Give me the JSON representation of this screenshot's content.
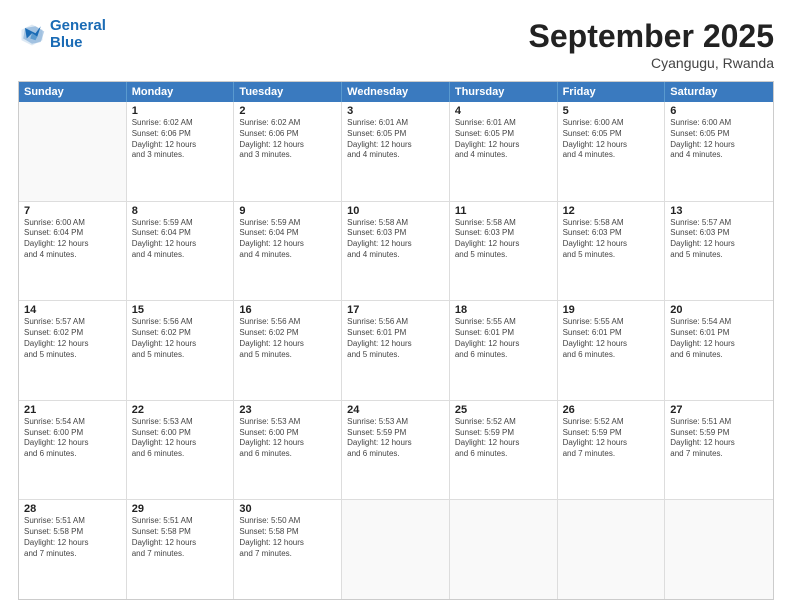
{
  "logo": {
    "line1": "General",
    "line2": "Blue"
  },
  "title": "September 2025",
  "subtitle": "Cyangugu, Rwanda",
  "header_days": [
    "Sunday",
    "Monday",
    "Tuesday",
    "Wednesday",
    "Thursday",
    "Friday",
    "Saturday"
  ],
  "rows": [
    [
      {
        "day": "",
        "info": ""
      },
      {
        "day": "1",
        "info": "Sunrise: 6:02 AM\nSunset: 6:06 PM\nDaylight: 12 hours\nand 3 minutes."
      },
      {
        "day": "2",
        "info": "Sunrise: 6:02 AM\nSunset: 6:06 PM\nDaylight: 12 hours\nand 3 minutes."
      },
      {
        "day": "3",
        "info": "Sunrise: 6:01 AM\nSunset: 6:05 PM\nDaylight: 12 hours\nand 4 minutes."
      },
      {
        "day": "4",
        "info": "Sunrise: 6:01 AM\nSunset: 6:05 PM\nDaylight: 12 hours\nand 4 minutes."
      },
      {
        "day": "5",
        "info": "Sunrise: 6:00 AM\nSunset: 6:05 PM\nDaylight: 12 hours\nand 4 minutes."
      },
      {
        "day": "6",
        "info": "Sunrise: 6:00 AM\nSunset: 6:05 PM\nDaylight: 12 hours\nand 4 minutes."
      }
    ],
    [
      {
        "day": "7",
        "info": "Sunrise: 6:00 AM\nSunset: 6:04 PM\nDaylight: 12 hours\nand 4 minutes."
      },
      {
        "day": "8",
        "info": "Sunrise: 5:59 AM\nSunset: 6:04 PM\nDaylight: 12 hours\nand 4 minutes."
      },
      {
        "day": "9",
        "info": "Sunrise: 5:59 AM\nSunset: 6:04 PM\nDaylight: 12 hours\nand 4 minutes."
      },
      {
        "day": "10",
        "info": "Sunrise: 5:58 AM\nSunset: 6:03 PM\nDaylight: 12 hours\nand 4 minutes."
      },
      {
        "day": "11",
        "info": "Sunrise: 5:58 AM\nSunset: 6:03 PM\nDaylight: 12 hours\nand 5 minutes."
      },
      {
        "day": "12",
        "info": "Sunrise: 5:58 AM\nSunset: 6:03 PM\nDaylight: 12 hours\nand 5 minutes."
      },
      {
        "day": "13",
        "info": "Sunrise: 5:57 AM\nSunset: 6:03 PM\nDaylight: 12 hours\nand 5 minutes."
      }
    ],
    [
      {
        "day": "14",
        "info": "Sunrise: 5:57 AM\nSunset: 6:02 PM\nDaylight: 12 hours\nand 5 minutes."
      },
      {
        "day": "15",
        "info": "Sunrise: 5:56 AM\nSunset: 6:02 PM\nDaylight: 12 hours\nand 5 minutes."
      },
      {
        "day": "16",
        "info": "Sunrise: 5:56 AM\nSunset: 6:02 PM\nDaylight: 12 hours\nand 5 minutes."
      },
      {
        "day": "17",
        "info": "Sunrise: 5:56 AM\nSunset: 6:01 PM\nDaylight: 12 hours\nand 5 minutes."
      },
      {
        "day": "18",
        "info": "Sunrise: 5:55 AM\nSunset: 6:01 PM\nDaylight: 12 hours\nand 6 minutes."
      },
      {
        "day": "19",
        "info": "Sunrise: 5:55 AM\nSunset: 6:01 PM\nDaylight: 12 hours\nand 6 minutes."
      },
      {
        "day": "20",
        "info": "Sunrise: 5:54 AM\nSunset: 6:01 PM\nDaylight: 12 hours\nand 6 minutes."
      }
    ],
    [
      {
        "day": "21",
        "info": "Sunrise: 5:54 AM\nSunset: 6:00 PM\nDaylight: 12 hours\nand 6 minutes."
      },
      {
        "day": "22",
        "info": "Sunrise: 5:53 AM\nSunset: 6:00 PM\nDaylight: 12 hours\nand 6 minutes."
      },
      {
        "day": "23",
        "info": "Sunrise: 5:53 AM\nSunset: 6:00 PM\nDaylight: 12 hours\nand 6 minutes."
      },
      {
        "day": "24",
        "info": "Sunrise: 5:53 AM\nSunset: 5:59 PM\nDaylight: 12 hours\nand 6 minutes."
      },
      {
        "day": "25",
        "info": "Sunrise: 5:52 AM\nSunset: 5:59 PM\nDaylight: 12 hours\nand 6 minutes."
      },
      {
        "day": "26",
        "info": "Sunrise: 5:52 AM\nSunset: 5:59 PM\nDaylight: 12 hours\nand 7 minutes."
      },
      {
        "day": "27",
        "info": "Sunrise: 5:51 AM\nSunset: 5:59 PM\nDaylight: 12 hours\nand 7 minutes."
      }
    ],
    [
      {
        "day": "28",
        "info": "Sunrise: 5:51 AM\nSunset: 5:58 PM\nDaylight: 12 hours\nand 7 minutes."
      },
      {
        "day": "29",
        "info": "Sunrise: 5:51 AM\nSunset: 5:58 PM\nDaylight: 12 hours\nand 7 minutes."
      },
      {
        "day": "30",
        "info": "Sunrise: 5:50 AM\nSunset: 5:58 PM\nDaylight: 12 hours\nand 7 minutes."
      },
      {
        "day": "",
        "info": ""
      },
      {
        "day": "",
        "info": ""
      },
      {
        "day": "",
        "info": ""
      },
      {
        "day": "",
        "info": ""
      }
    ]
  ]
}
